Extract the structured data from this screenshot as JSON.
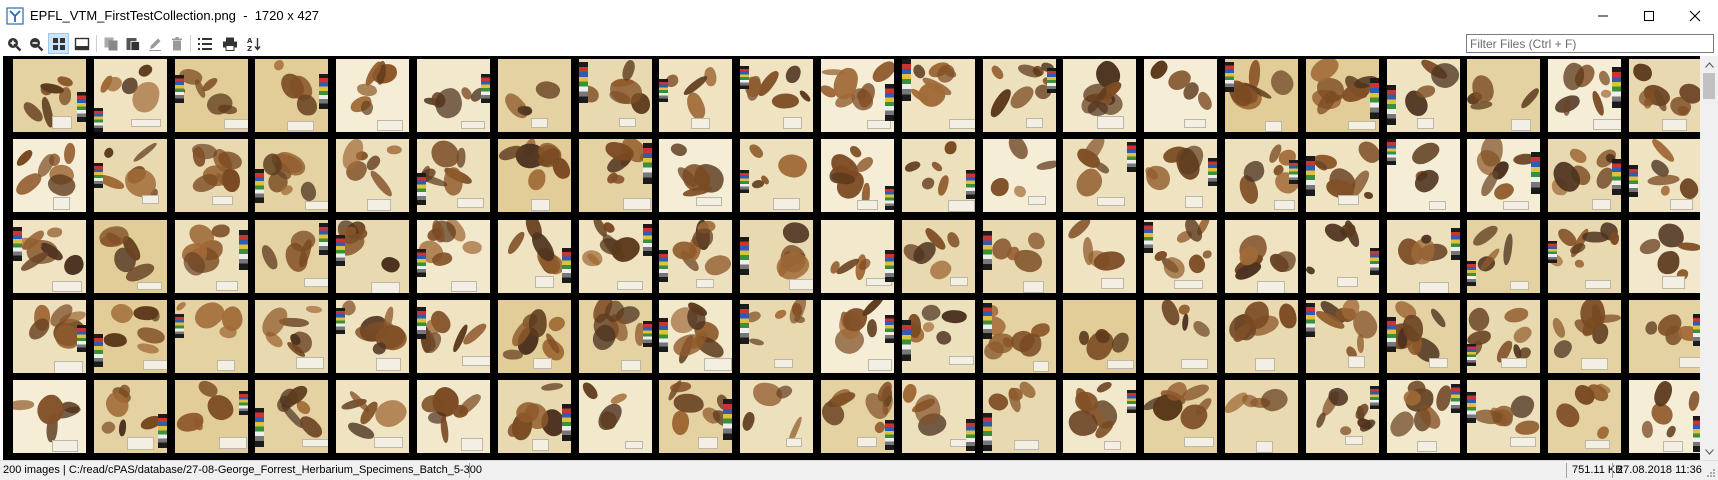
{
  "window": {
    "title": "EPFL_VTM_FirstTestCollection.png",
    "dimensions": "1720 x 427",
    "minimize_icon": "minimize-icon",
    "maximize_icon": "maximize-icon",
    "close_icon": "close-icon"
  },
  "toolbar": {
    "buttons": [
      {
        "icon": "zoom-in-icon"
      },
      {
        "icon": "zoom-out-icon"
      },
      {
        "icon": "thumbnail-grid-icon",
        "active": true
      },
      {
        "icon": "single-view-icon"
      },
      {
        "icon": "copy-icon"
      },
      {
        "icon": "paste-icon"
      },
      {
        "icon": "rename-icon"
      },
      {
        "icon": "delete-icon"
      },
      {
        "icon": "list-icon"
      },
      {
        "icon": "print-icon"
      },
      {
        "icon": "sort-az-icon"
      }
    ],
    "filter_placeholder": "Filter Files (Ctrl + F)",
    "filter_value": ""
  },
  "gallery": {
    "rows": 5,
    "columns": 21,
    "visible_thumbnails": 105,
    "subject": "herbarium specimen sheets"
  },
  "statusbar": {
    "left": "200 images | C:/read/cPAS/database/27-08-George_Forrest_Herbarium_Specimens_Batch_5-300",
    "size": "751.11 KB",
    "date": "27.08.2018 11:36"
  },
  "colors": {
    "gallery_background": "#000000",
    "paper_tones": [
      "#efe3c2",
      "#e9d9b0",
      "#f2e8cc",
      "#e4d2a3",
      "#ede0bd",
      "#f5edd6",
      "#e2cc98"
    ],
    "specimen_tones": [
      "#7a4a22",
      "#5c3a1c",
      "#8f5a2b",
      "#6b4424",
      "#a06a37",
      "#4d3320",
      "#815027"
    ],
    "selection_accent": "#cce4f7"
  }
}
